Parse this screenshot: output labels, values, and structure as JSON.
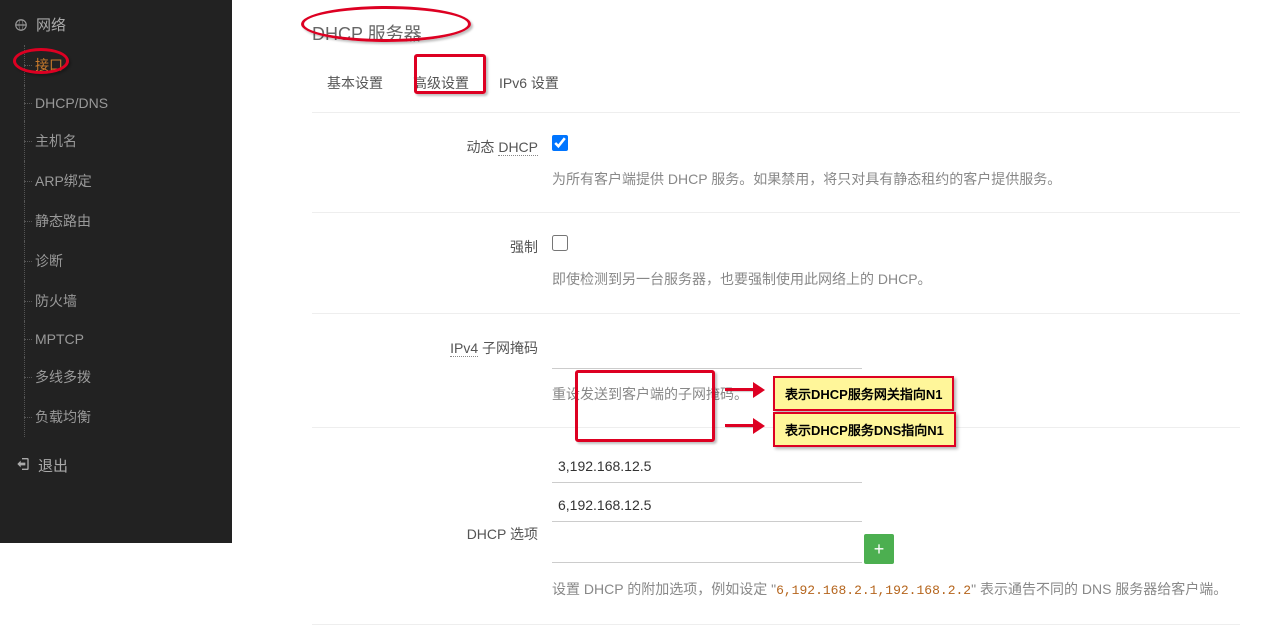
{
  "sidebar": {
    "section_label": "网络",
    "items": [
      {
        "label": "接口",
        "active": true
      },
      {
        "label": "DHCP/DNS"
      },
      {
        "label": "主机名"
      },
      {
        "label": "ARP绑定"
      },
      {
        "label": "静态路由"
      },
      {
        "label": "诊断"
      },
      {
        "label": "防火墙"
      },
      {
        "label": "MPTCP"
      },
      {
        "label": "多线多拨"
      },
      {
        "label": "负载均衡"
      }
    ],
    "logout_label": "退出"
  },
  "page": {
    "title": "DHCP 服务器",
    "tabs": [
      {
        "label": "基本设置"
      },
      {
        "label": "高级设置",
        "active": true
      },
      {
        "label": "IPv6 设置"
      }
    ]
  },
  "fields": {
    "dyn_dhcp": {
      "label_prefix": "动态 ",
      "label_dotted": "DHCP",
      "checked": true,
      "help": "为所有客户端提供 DHCP 服务。如果禁用，将只对具有静态租约的客户提供服务。"
    },
    "force": {
      "label": "强制",
      "checked": false,
      "help": "即使检测到另一台服务器，也要强制使用此网络上的 DHCP。"
    },
    "netmask": {
      "label_dotted": "IPv4",
      "label_suffix": " 子网掩码",
      "value": "",
      "help": "重设发送到客户端的子网掩码。"
    },
    "dhcp_options": {
      "label": "DHCP 选项",
      "values": [
        "3,192.168.12.5",
        "6,192.168.12.5"
      ],
      "add_glyph": "+",
      "help_pre": "设置 DHCP 的附加选项，例如设定 \"",
      "help_sample": "6,192.168.2.1,192.168.2.2",
      "help_post": "\" 表示通告不同的 DNS 服务器给客户端。"
    }
  },
  "annotations": {
    "callout_gateway": "表示DHCP服务网关指向N1",
    "callout_dns": "表示DHCP服务DNS指向N1"
  }
}
